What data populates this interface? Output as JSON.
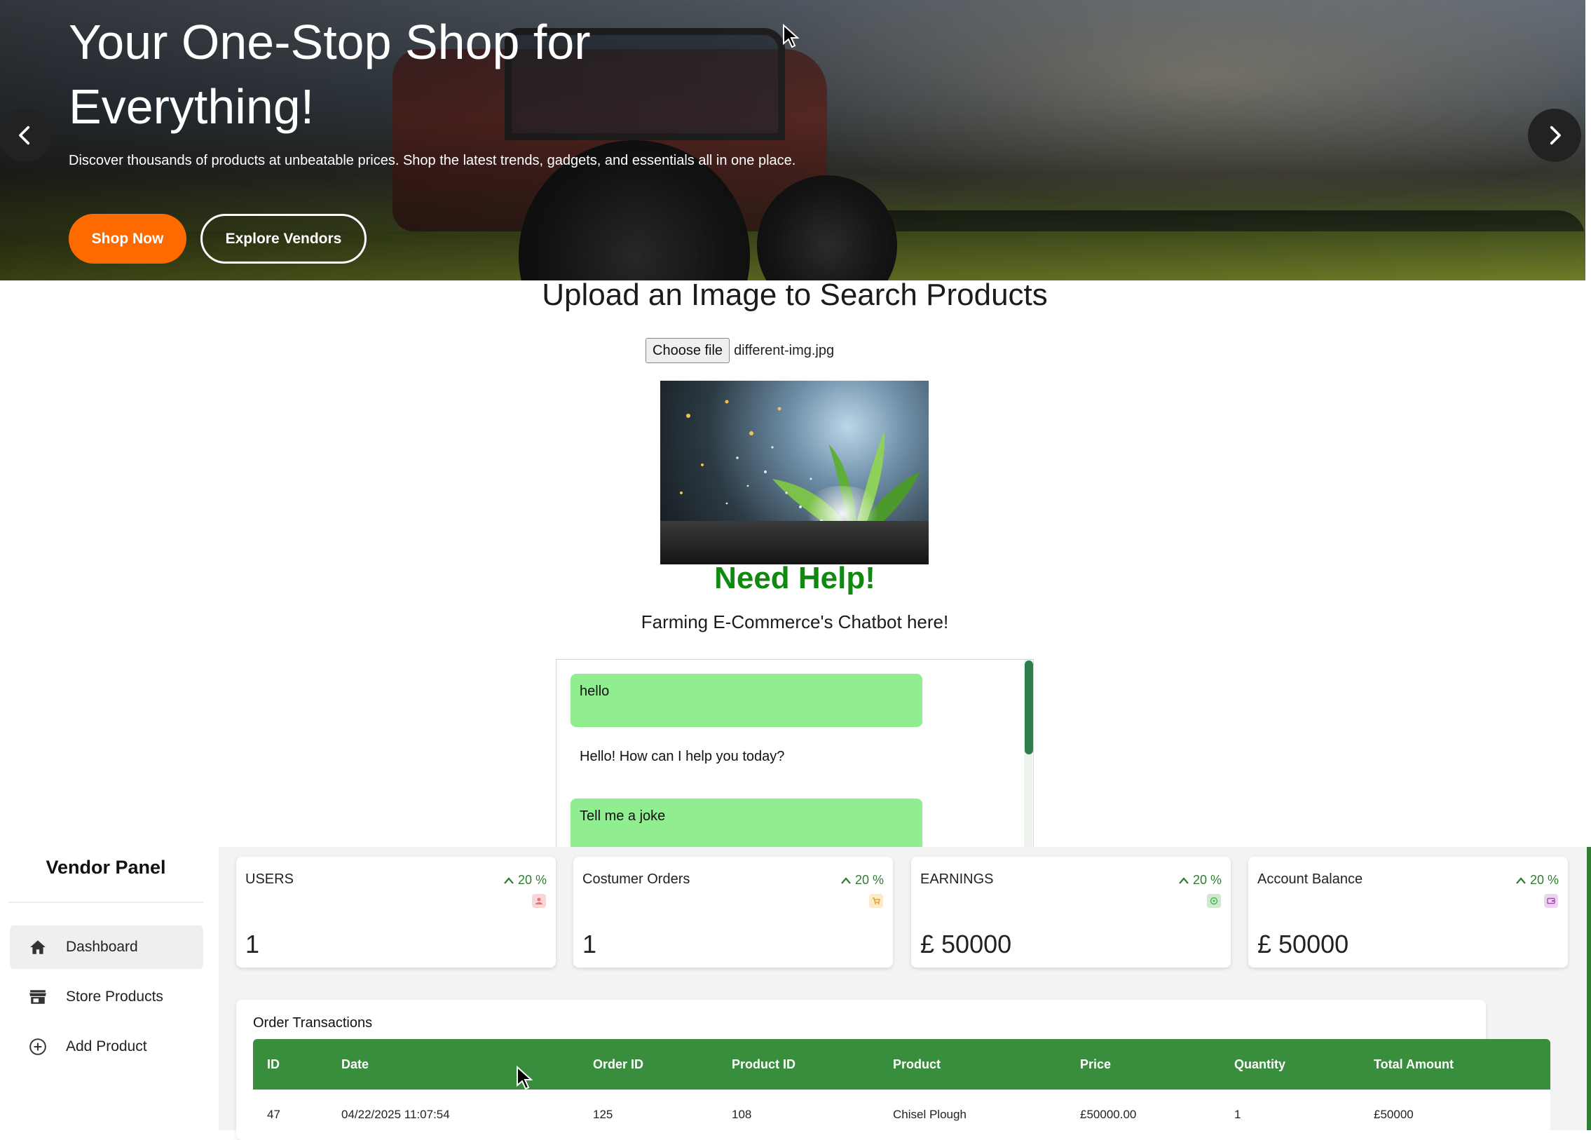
{
  "hero": {
    "title": "Your One-Stop Shop for Everything!",
    "subtitle": "Discover thousands of products at unbeatable prices. Shop the latest trends, gadgets, and essentials all in one place.",
    "primary_button": "Shop Now",
    "secondary_button": "Explore Vendors",
    "prev_icon": "chevron-left-icon",
    "next_icon": "chevron-right-icon"
  },
  "image_search": {
    "heading": "Upload an Image to Search Products",
    "choose_button": "Choose file",
    "file_name": "different-img.jpg"
  },
  "chatbot": {
    "heading": "Need Help!",
    "subheading": "Farming E-Commerce's Chatbot here!",
    "messages": [
      {
        "from": "user",
        "text": "hello"
      },
      {
        "from": "bot",
        "text": "Hello! How can I help you today?"
      },
      {
        "from": "user",
        "text": "Tell me a joke"
      }
    ]
  },
  "vendor_panel": {
    "title": "Vendor Panel",
    "nav": [
      {
        "label": "Dashboard",
        "icon": "home-icon",
        "active": true
      },
      {
        "label": "Store Products",
        "icon": "store-icon",
        "active": false
      },
      {
        "label": "Add Product",
        "icon": "add-circle-icon",
        "active": false
      }
    ],
    "stats": [
      {
        "label": "USERS",
        "change": "20 %",
        "value": "1",
        "badge_icon": "user-icon",
        "badge_color": "#f9d5d5"
      },
      {
        "label": "Costumer Orders",
        "change": "20 %",
        "value": "1",
        "badge_icon": "cart-icon",
        "badge_color": "#fbecc7"
      },
      {
        "label": "EARNINGS",
        "change": "20 %",
        "value": "£ 50000",
        "badge_icon": "money-icon",
        "badge_color": "#cfe9cf"
      },
      {
        "label": "Account Balance",
        "change": "20 %",
        "value": "£ 50000",
        "badge_icon": "wallet-icon",
        "badge_color": "#ecd3ee"
      }
    ],
    "orders": {
      "title": "Order Transactions",
      "columns": [
        "ID",
        "Date",
        "Order ID",
        "Product ID",
        "Product",
        "Price",
        "Quantity",
        "Total Amount"
      ],
      "rows": [
        [
          "47",
          "04/22/2025 11:07:54",
          "125",
          "108",
          "Chisel Plough",
          "£50000.00",
          "1",
          "£50000"
        ]
      ]
    }
  },
  "colors": {
    "accent_orange": "#ff6a00",
    "help_green": "#0f8a0f",
    "chat_user_bubble": "#90ee90",
    "table_header_green": "#388e3c",
    "trend_green": "#2e7d32"
  }
}
